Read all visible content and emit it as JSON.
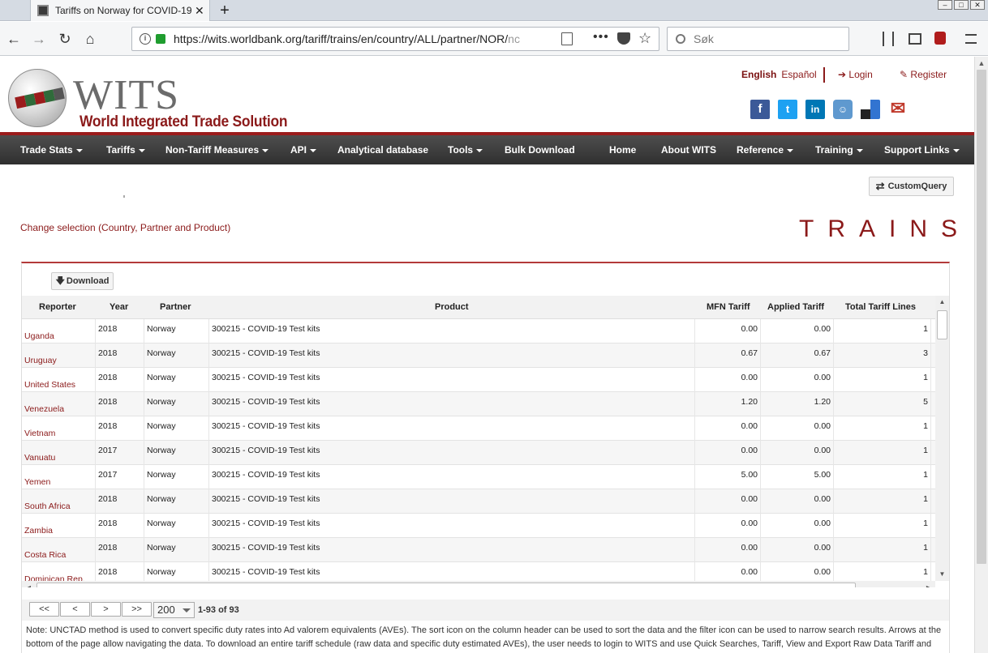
{
  "browser": {
    "tab_title": "Tariffs on Norway for COVID-19",
    "url_main": "https://wits.worldbank.org/tariff/trains/en/country/ALL/partner/NOR/",
    "url_dim": "nc",
    "search_placeholder": "Søk"
  },
  "header": {
    "logo_title": "WITS",
    "logo_subtitle": "World Integrated Trade Solution",
    "lang_english": "English",
    "lang_spanish": "Español",
    "login": "Login",
    "register": "Register",
    "social": [
      "facebook-icon",
      "twitter-icon",
      "linkedin-icon",
      "reddit-icon",
      "delicious-icon",
      "email-icon"
    ]
  },
  "menu": [
    {
      "label": "Trade Stats",
      "dropdown": true
    },
    {
      "label": "Tariffs",
      "dropdown": true
    },
    {
      "label": "Non-Tariff Measures",
      "dropdown": true
    },
    {
      "label": "API",
      "dropdown": true
    },
    {
      "label": "Analytical database",
      "dropdown": false
    },
    {
      "label": "Tools",
      "dropdown": true
    },
    {
      "label": "Bulk Download",
      "dropdown": false
    },
    {
      "label": "Home",
      "dropdown": false
    },
    {
      "label": "About WITS",
      "dropdown": false
    },
    {
      "label": "Reference",
      "dropdown": true
    },
    {
      "label": "Training",
      "dropdown": true
    },
    {
      "label": "Support Links",
      "dropdown": true
    }
  ],
  "main": {
    "custom_query": "CustomQuery",
    "change_selection": "Change selection (Country, Partner and Product)",
    "brand": "TRAINS",
    "download": "Download"
  },
  "grid": {
    "columns": [
      "Reporter",
      "Year",
      "Partner",
      "Product",
      "MFN Tariff",
      "Applied Tariff",
      "Total Tariff Lines"
    ],
    "rows": [
      [
        "Uganda",
        "2018",
        "Norway",
        "300215 - COVID-19 Test kits",
        "0.00",
        "0.00",
        "1"
      ],
      [
        "Uruguay",
        "2018",
        "Norway",
        "300215 - COVID-19 Test kits",
        "0.67",
        "0.67",
        "3"
      ],
      [
        "United States",
        "2018",
        "Norway",
        "300215 - COVID-19 Test kits",
        "0.00",
        "0.00",
        "1"
      ],
      [
        "Venezuela",
        "2018",
        "Norway",
        "300215 - COVID-19 Test kits",
        "1.20",
        "1.20",
        "5"
      ],
      [
        "Vietnam",
        "2018",
        "Norway",
        "300215 - COVID-19 Test kits",
        "0.00",
        "0.00",
        "1"
      ],
      [
        "Vanuatu",
        "2017",
        "Norway",
        "300215 - COVID-19 Test kits",
        "0.00",
        "0.00",
        "1"
      ],
      [
        "Yemen",
        "2017",
        "Norway",
        "300215 - COVID-19 Test kits",
        "5.00",
        "5.00",
        "1"
      ],
      [
        "South Africa",
        "2018",
        "Norway",
        "300215 - COVID-19 Test kits",
        "0.00",
        "0.00",
        "1"
      ],
      [
        "Zambia",
        "2018",
        "Norway",
        "300215 - COVID-19 Test kits",
        "0.00",
        "0.00",
        "1"
      ],
      [
        "Costa Rica",
        "2018",
        "Norway",
        "300215 - COVID-19 Test kits",
        "0.00",
        "0.00",
        "1"
      ],
      [
        "Dominican Rep.",
        "2018",
        "Norway",
        "300215 - COVID-19 Test kits",
        "0.00",
        "0.00",
        "1"
      ]
    ]
  },
  "pager": {
    "first": "<<",
    "prev": "<",
    "next": ">",
    "last": ">>",
    "page_size": "200",
    "info": "1-93 of 93"
  },
  "note": "Note: UNCTAD method is used to convert specific duty rates into Ad valorem equivalents (AVEs). The sort icon on the column header can be used to sort the data and the filter icon can be used to narrow search results. Arrows at the bottom of the page allow navigating the data. To download an entire tariff schedule (raw data and specific duty estimated AVEs), the user needs to login to WITS and use Quick Searches, Tariff, View and Export Raw Data Tariff and TRAINS...",
  "colors": {
    "brand_red": "#8b1a1a",
    "menu_bg": "#3a3a3a"
  }
}
